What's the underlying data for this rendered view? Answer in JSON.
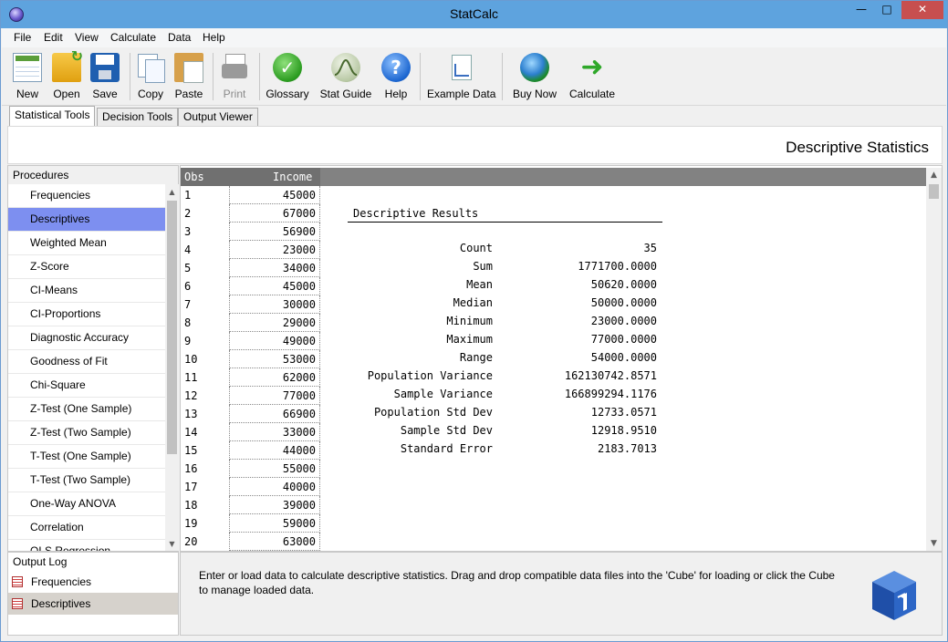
{
  "window": {
    "title": "StatCalc"
  },
  "menu": [
    "File",
    "Edit",
    "View",
    "Calculate",
    "Data",
    "Help"
  ],
  "toolbar": {
    "new": "New",
    "open": "Open",
    "save": "Save",
    "copy": "Copy",
    "paste": "Paste",
    "print": "Print",
    "glossary": "Glossary",
    "stat_guide": "Stat Guide",
    "help": "Help",
    "example_data": "Example Data",
    "buy_now": "Buy Now",
    "calculate": "Calculate"
  },
  "tabs": [
    "Statistical Tools",
    "Decision Tools",
    "Output Viewer"
  ],
  "header_title": "Descriptive Statistics",
  "procedures": {
    "header": "Procedures",
    "items": [
      "Frequencies",
      "Descriptives",
      "Weighted Mean",
      "Z-Score",
      "CI-Means",
      "CI-Proportions",
      "Diagnostic Accuracy",
      "Goodness of Fit",
      "Chi-Square",
      "Z-Test (One Sample)",
      "Z-Test (Two Sample)",
      "T-Test (One Sample)",
      "T-Test (Two Sample)",
      "One-Way ANOVA",
      "Correlation",
      "OLS Regression"
    ],
    "selected": "Descriptives"
  },
  "output_log": {
    "header": "Output Log",
    "items": [
      "Frequencies",
      "Descriptives"
    ],
    "selected": "Descriptives"
  },
  "grid": {
    "columns": [
      "Obs",
      "Income"
    ],
    "rows": [
      [
        "1",
        "45000"
      ],
      [
        "2",
        "67000"
      ],
      [
        "3",
        "56900"
      ],
      [
        "4",
        "23000"
      ],
      [
        "5",
        "34000"
      ],
      [
        "6",
        "45000"
      ],
      [
        "7",
        "30000"
      ],
      [
        "8",
        "29000"
      ],
      [
        "9",
        "49000"
      ],
      [
        "10",
        "53000"
      ],
      [
        "11",
        "62000"
      ],
      [
        "12",
        "77000"
      ],
      [
        "13",
        "66900"
      ],
      [
        "14",
        "33000"
      ],
      [
        "15",
        "44000"
      ],
      [
        "16",
        "55000"
      ],
      [
        "17",
        "40000"
      ],
      [
        "18",
        "39000"
      ],
      [
        "19",
        "59000"
      ],
      [
        "20",
        "63000"
      ]
    ]
  },
  "results": {
    "title": "Descriptive Results",
    "rows": [
      [
        "Count",
        "35"
      ],
      [
        "Sum",
        "1771700.0000"
      ],
      [
        "Mean",
        "50620.0000"
      ],
      [
        "Median",
        "50000.0000"
      ],
      [
        "Minimum",
        "23000.0000"
      ],
      [
        "Maximum",
        "77000.0000"
      ],
      [
        "Range",
        "54000.0000"
      ],
      [
        "Population Variance",
        "162130742.8571"
      ],
      [
        "Sample Variance",
        "166899294.1176"
      ],
      [
        "Population Std Dev",
        "12733.0571"
      ],
      [
        "Sample Std Dev",
        "12918.9510"
      ],
      [
        "Standard Error",
        "2183.7013"
      ]
    ]
  },
  "info_text": "Enter or load data to calculate descriptive statistics.  Drag and drop compatible data files into the 'Cube' for loading or click the Cube to manage loaded data.",
  "colors": {
    "titlebar": "#5ea3de",
    "selection": "#7d8ff0",
    "grid_header": "#828282",
    "close_button": "#c74f4f"
  }
}
